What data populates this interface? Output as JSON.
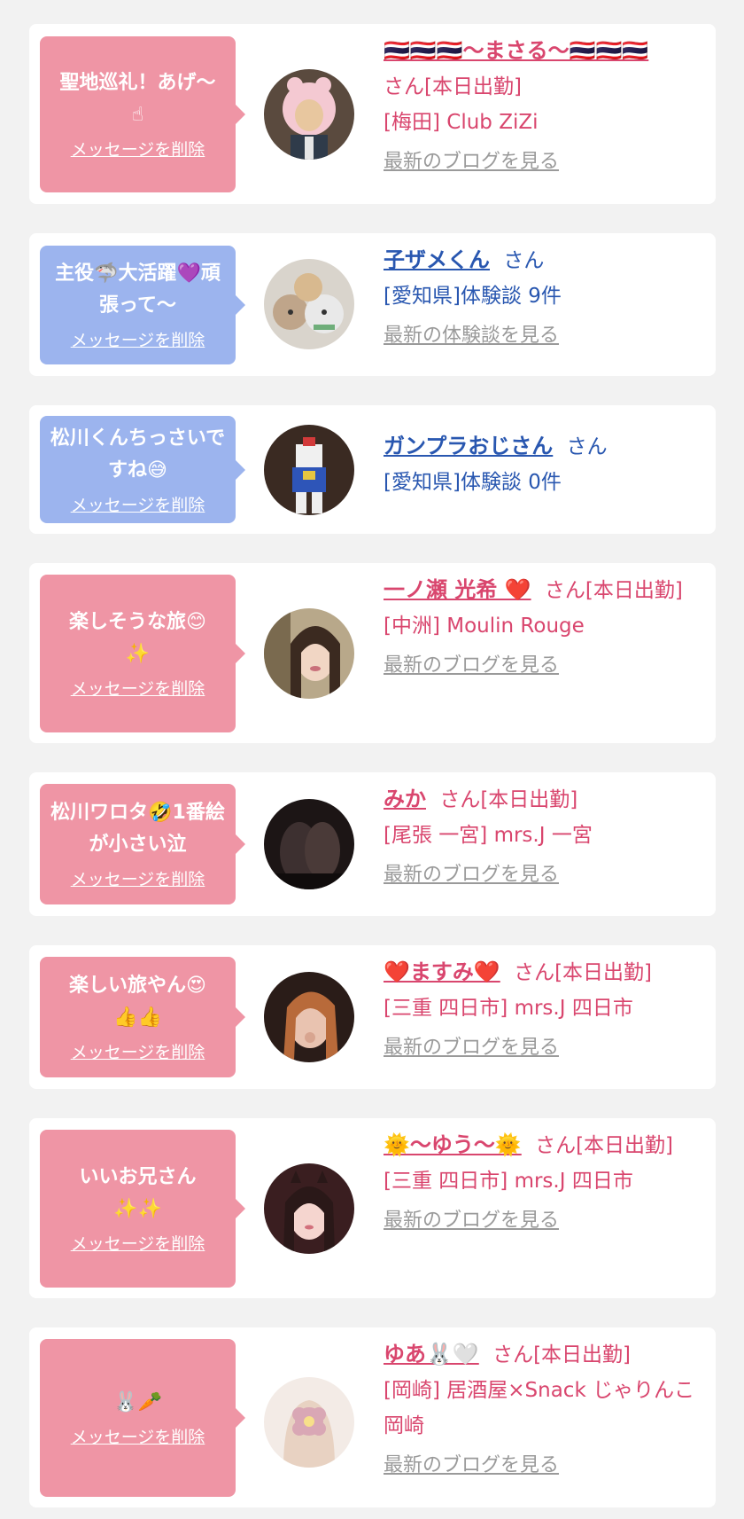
{
  "cards": [
    {
      "message": "聖地巡礼！あげ〜",
      "message_emoji": "☝",
      "delete_label": "メッセージを削除",
      "name": "🇹🇭🇹🇭🇹🇭〜まさる〜🇹🇭🇹🇭🇹🇭",
      "suffix": "さん[本日出勤]",
      "detail": "[梅田] Club ZiZi",
      "link": "最新のブログを見る"
    },
    {
      "message": "主役🦈大活躍💜頑張って〜",
      "delete_label": "メッセージを削除",
      "name": "子ザメくん",
      "suffix": "さん",
      "detail": "[愛知県]体験談 9件",
      "link": "最新の体験談を見る"
    },
    {
      "message": "松川くんちっさいですね😅",
      "delete_label": "メッセージを削除",
      "name": "ガンプラおじさん",
      "suffix": "さん",
      "detail": "[愛知県]体験談 0件"
    },
    {
      "message": "楽しそうな旅😊",
      "message_emoji": "✨",
      "delete_label": "メッセージを削除",
      "name": "一ノ瀬 光希 ❤️",
      "suffix": "さん[本日出勤]",
      "detail": "[中洲] Moulin Rouge",
      "link": "最新のブログを見る"
    },
    {
      "message": "松川ワロタ🤣1番絵が小さい泣",
      "delete_label": "メッセージを削除",
      "name": "みか",
      "suffix": "さん[本日出勤]",
      "detail": "[尾張 一宮] mrs.J 一宮",
      "link": "最新のブログを見る"
    },
    {
      "message": "楽しい旅やん😍",
      "message_emoji": "👍👍",
      "delete_label": "メッセージを削除",
      "name": "❤️ますみ❤️",
      "suffix": "さん[本日出勤]",
      "detail": "[三重 四日市] mrs.J 四日市",
      "link": "最新のブログを見る"
    },
    {
      "message": "いいお兄さん",
      "message_emoji": "✨✨",
      "delete_label": "メッセージを削除",
      "name": "🌞〜ゆう〜🌞",
      "suffix": "さん[本日出勤]",
      "detail": "[三重 四日市] mrs.J 四日市",
      "link": "最新のブログを見る"
    },
    {
      "message": "🐰🥕",
      "delete_label": "メッセージを削除",
      "name": "ゆあ🐰🤍",
      "suffix": "さん[本日出勤]",
      "detail": "[岡崎] 居酒屋×Snack じゃりんこ岡崎",
      "link": "最新のブログを見る"
    }
  ],
  "colors": {
    "pink_bubble": "#ef95a5",
    "blue_bubble": "#9cb4ee",
    "pink_text": "#d9466e",
    "blue_text": "#2957b0",
    "link_gray": "#9a9a9a"
  }
}
